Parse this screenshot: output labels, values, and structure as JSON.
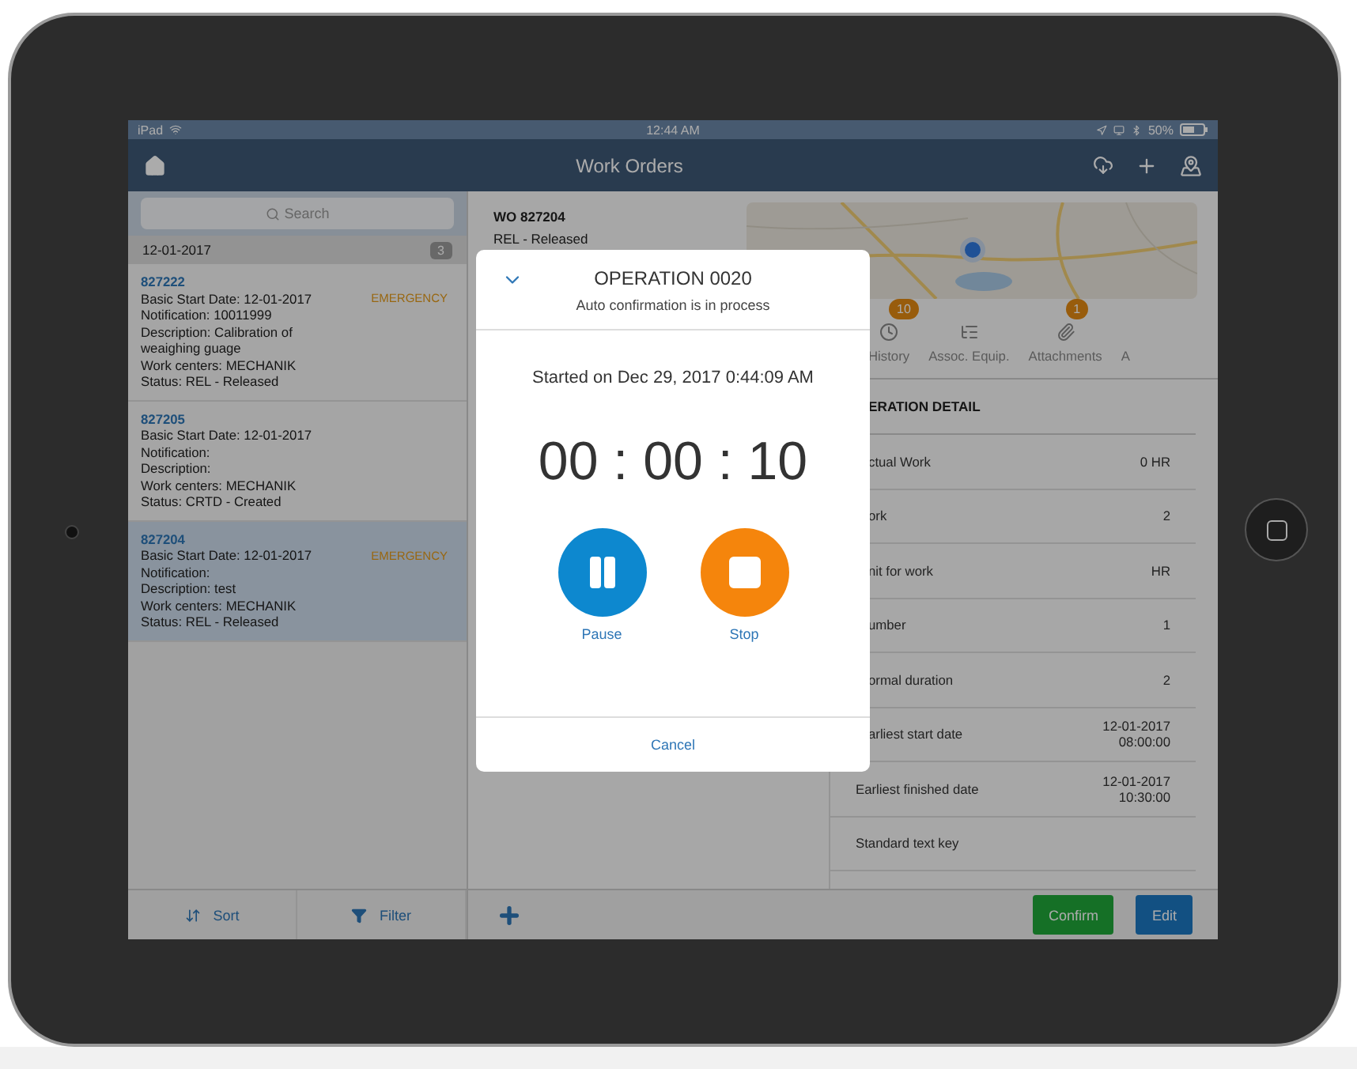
{
  "status_bar": {
    "device": "iPad",
    "time": "12:44 AM",
    "battery": "50%"
  },
  "nav": {
    "title": "Work Orders"
  },
  "sidebar": {
    "search": {
      "placeholder": "Search"
    },
    "group": {
      "date": "12-01-2017",
      "count": "3"
    },
    "items": [
      {
        "number": "827222",
        "lines": [
          "Basic Start Date: 12-01-2017",
          "Notification: 10011999",
          "Description: Calibration of weaighing guage",
          "Work centers: MECHANIK",
          "Status: REL - Released"
        ],
        "tag": "EMERGENCY",
        "selected": false
      },
      {
        "number": "827205",
        "lines": [
          "Basic Start Date: 12-01-2017",
          "Notification:",
          "Description:",
          "Work centers: MECHANIK",
          "Status: CRTD - Created"
        ],
        "selected": false
      },
      {
        "number": "827204",
        "lines": [
          "Basic Start Date: 12-01-2017",
          "Notification:",
          "Description: test",
          "Work centers: MECHANIK",
          "Status: REL - Released"
        ],
        "tag": "EMERGENCY",
        "selected": true
      }
    ]
  },
  "detail": {
    "title": "WO 827204",
    "status": "REL - Released",
    "tabs": [
      {
        "label": "History",
        "badge": "10"
      },
      {
        "label": "Assoc. Equip."
      },
      {
        "label": "Attachments",
        "badge": "1"
      },
      {
        "label": "A"
      }
    ],
    "section_title": "ERATION DETAIL",
    "rows": [
      {
        "label": "ctual Work",
        "value": [
          "0 HR"
        ],
        "clipped": true
      },
      {
        "label": "ork",
        "value": [
          "2"
        ],
        "clipped": true
      },
      {
        "label": "nit for work",
        "value": [
          "HR"
        ],
        "clipped": true
      },
      {
        "label": "umber",
        "value": [
          "1"
        ],
        "clipped": true
      },
      {
        "label": "ormal duration",
        "value": [
          "2"
        ],
        "clipped": true
      },
      {
        "label": "arliest start date",
        "value": [
          "12-01-2017",
          "08:00:00"
        ],
        "clipped": true
      },
      {
        "label": "Earliest finished date",
        "value": [
          "12-01-2017",
          "10:30:00"
        ],
        "clipped": false
      },
      {
        "label": "Standard text key",
        "value": [],
        "clipped": false
      }
    ]
  },
  "modal": {
    "title": "OPERATION 0020",
    "subtitle": "Auto confirmation is in process",
    "started": "Started on Dec 29, 2017 0:44:09 AM",
    "timer": "00 : 00 : 10",
    "actions": [
      {
        "kind": "pause",
        "label": "Pause"
      },
      {
        "kind": "stop",
        "label": "Stop"
      }
    ],
    "cancel": "Cancel"
  },
  "footer": {
    "sort": "Sort",
    "filter": "Filter",
    "confirm": "Confirm",
    "edit": "Edit"
  }
}
